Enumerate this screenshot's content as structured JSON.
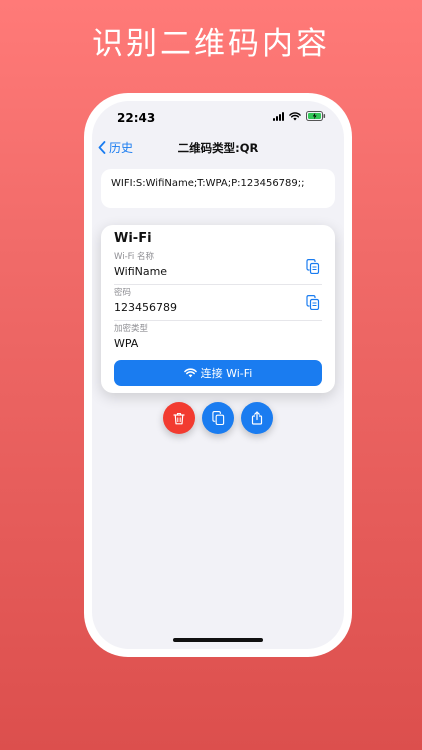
{
  "promo": {
    "title": "识别二维码内容"
  },
  "status_bar": {
    "time": "22:43"
  },
  "nav": {
    "back_label": "历史",
    "title": "二维码类型:QR"
  },
  "content": {
    "raw_text": "WIFI:S:WifiName;T:WPA;P:123456789;;"
  },
  "wifi_card": {
    "title": "Wi-Fi",
    "fields": [
      {
        "label": "Wi-Fi 名称",
        "value": "WifiName",
        "copyable": true
      },
      {
        "label": "密码",
        "value": "123456789",
        "copyable": true
      },
      {
        "label": "加密类型",
        "value": "WPA",
        "copyable": false
      }
    ],
    "connect_label": "连接 Wi-Fi"
  },
  "actions": [
    "trash-icon",
    "copy-icon",
    "share-icon"
  ],
  "colors": {
    "accent": "#1a7cf0",
    "danger": "#f23b30",
    "background_top": "#ff7a78",
    "background_bottom": "#dc4f4d"
  }
}
